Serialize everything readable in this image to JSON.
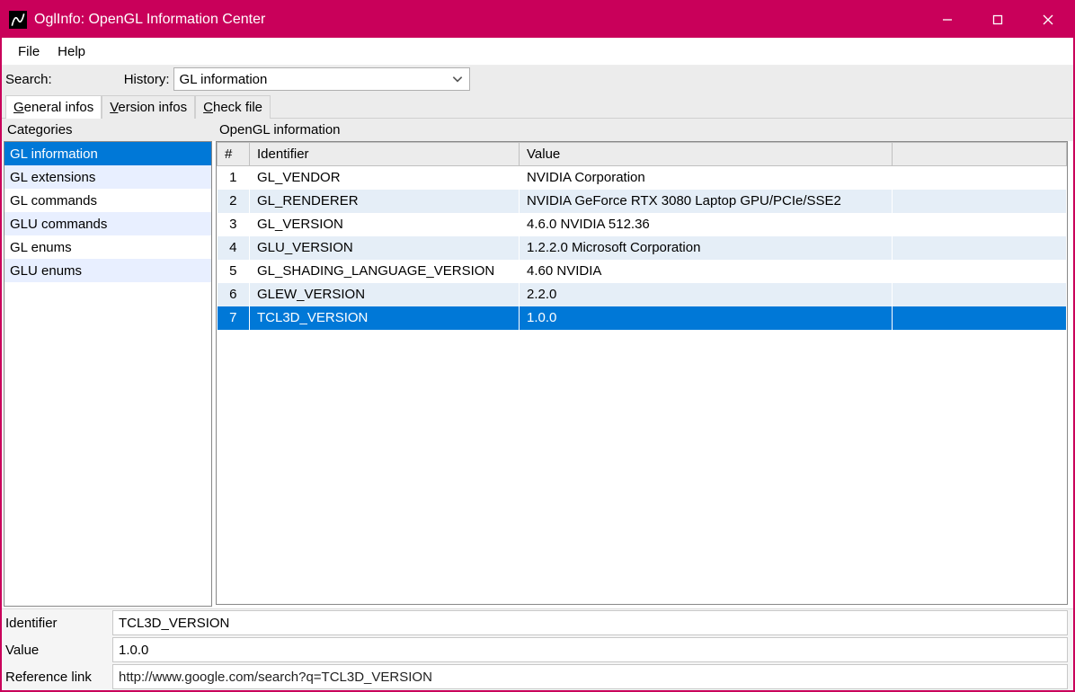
{
  "title": "OglInfo: OpenGL Information Center",
  "menu": {
    "file": "File",
    "help": "Help"
  },
  "search": {
    "search_label": "Search:",
    "history_label": "History:",
    "history_value": "GL information"
  },
  "tabs": {
    "general": "eneral infos",
    "version": "ersion infos",
    "check": "heck file"
  },
  "sidebar": {
    "header": "Categories",
    "items": [
      {
        "label": "GL information",
        "selected": true
      },
      {
        "label": "GL extensions",
        "selected": false
      },
      {
        "label": "GL commands",
        "selected": false
      },
      {
        "label": "GLU commands",
        "selected": false
      },
      {
        "label": "GL enums",
        "selected": false
      },
      {
        "label": "GLU enums",
        "selected": false
      }
    ]
  },
  "main": {
    "header": "OpenGL information",
    "columns": {
      "num": "#",
      "id": "Identifier",
      "val": "Value"
    },
    "rows": [
      {
        "n": "1",
        "id": "GL_VENDOR",
        "val": "NVIDIA Corporation"
      },
      {
        "n": "2",
        "id": "GL_RENDERER",
        "val": "NVIDIA GeForce RTX 3080 Laptop GPU/PCIe/SSE2"
      },
      {
        "n": "3",
        "id": "GL_VERSION",
        "val": "4.6.0 NVIDIA 512.36"
      },
      {
        "n": "4",
        "id": "GLU_VERSION",
        "val": "1.2.2.0 Microsoft Corporation"
      },
      {
        "n": "5",
        "id": "GL_SHADING_LANGUAGE_VERSION",
        "val": "4.60 NVIDIA"
      },
      {
        "n": "6",
        "id": "GLEW_VERSION",
        "val": "2.2.0"
      },
      {
        "n": "7",
        "id": "TCL3D_VERSION",
        "val": "1.0.0"
      }
    ],
    "selected_index": 6
  },
  "detail": {
    "identifier_label": "Identifier",
    "identifier_value": "TCL3D_VERSION",
    "value_label": "Value",
    "value_value": "1.0.0",
    "reference_label": "Reference link",
    "reference_value": "http://www.google.com/search?q=TCL3D_VERSION"
  }
}
